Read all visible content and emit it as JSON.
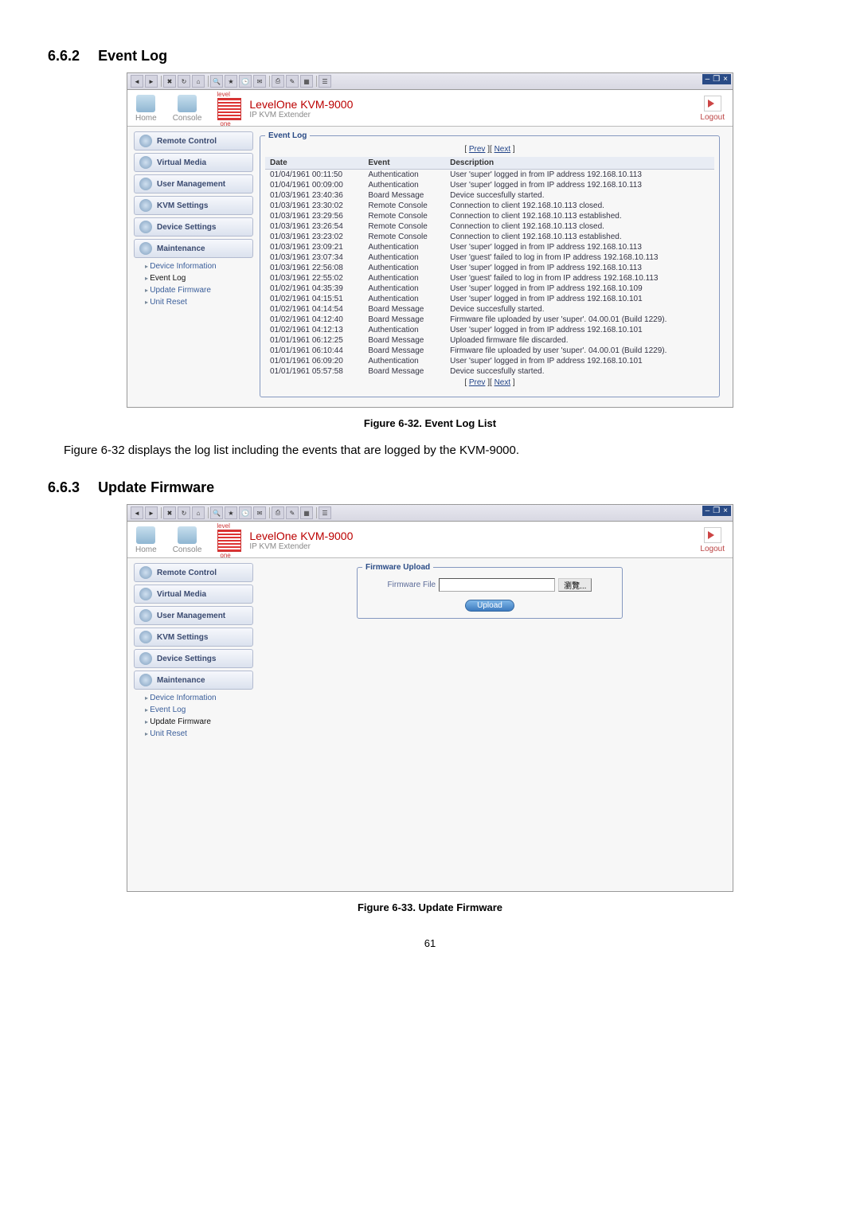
{
  "page_number": "61",
  "sections": {
    "s662": {
      "num": "6.6.2",
      "title": "Event Log"
    },
    "s663": {
      "num": "6.6.3",
      "title": "Update Firmware"
    }
  },
  "fig32": {
    "caption": "Figure 6-32. Event Log List"
  },
  "fig33": {
    "caption": "Figure 6-33. Update Firmware"
  },
  "body_line": "Figure 6-32 displays the log list including the events that are logged by the KVM-9000.",
  "brand": {
    "home": "Home",
    "console": "Console",
    "title": "LevelOne KVM-9000",
    "subtitle": "IP KVM Extender",
    "logout": "Logout"
  },
  "nav": {
    "remote_control": "Remote Control",
    "virtual_media": "Virtual Media",
    "user_management": "User Management",
    "kvm_settings": "KVM Settings",
    "device_settings": "Device Settings",
    "maintenance": "Maintenance",
    "device_information": "Device Information",
    "event_log": "Event Log",
    "update_firmware": "Update Firmware",
    "unit_reset": "Unit Reset"
  },
  "eventlog": {
    "legend": "Event Log",
    "prev": "Prev",
    "next": "Next",
    "columns": {
      "date": "Date",
      "event": "Event",
      "description": "Description"
    },
    "rows": [
      {
        "date": "01/04/1961 00:11:50",
        "event": "Authentication",
        "desc": "User 'super' logged in from IP address 192.168.10.113"
      },
      {
        "date": "01/04/1961 00:09:00",
        "event": "Authentication",
        "desc": "User 'super' logged in from IP address 192.168.10.113"
      },
      {
        "date": "01/03/1961 23:40:36",
        "event": "Board Message",
        "desc": "Device succesfully started."
      },
      {
        "date": "01/03/1961 23:30:02",
        "event": "Remote Console",
        "desc": "Connection to client 192.168.10.113 closed."
      },
      {
        "date": "01/03/1961 23:29:56",
        "event": "Remote Console",
        "desc": "Connection to client 192.168.10.113 established."
      },
      {
        "date": "01/03/1961 23:26:54",
        "event": "Remote Console",
        "desc": "Connection to client 192.168.10.113 closed."
      },
      {
        "date": "01/03/1961 23:23:02",
        "event": "Remote Console",
        "desc": "Connection to client 192.168.10.113 established."
      },
      {
        "date": "01/03/1961 23:09:21",
        "event": "Authentication",
        "desc": "User 'super' logged in from IP address 192.168.10.113"
      },
      {
        "date": "01/03/1961 23:07:34",
        "event": "Authentication",
        "desc": "User 'guest' failed to log in from IP address 192.168.10.113"
      },
      {
        "date": "01/03/1961 22:56:08",
        "event": "Authentication",
        "desc": "User 'super' logged in from IP address 192.168.10.113"
      },
      {
        "date": "01/03/1961 22:55:02",
        "event": "Authentication",
        "desc": "User 'guest' failed to log in from IP address 192.168.10.113"
      },
      {
        "date": "01/02/1961 04:35:39",
        "event": "Authentication",
        "desc": "User 'super' logged in from IP address 192.168.10.109"
      },
      {
        "date": "01/02/1961 04:15:51",
        "event": "Authentication",
        "desc": "User 'super' logged in from IP address 192.168.10.101"
      },
      {
        "date": "01/02/1961 04:14:54",
        "event": "Board Message",
        "desc": "Device succesfully started."
      },
      {
        "date": "01/02/1961 04:12:40",
        "event": "Board Message",
        "desc": "Firmware file uploaded by user 'super'. 04.00.01 (Build 1229)."
      },
      {
        "date": "01/02/1961 04:12:13",
        "event": "Authentication",
        "desc": "User 'super' logged in from IP address 192.168.10.101"
      },
      {
        "date": "01/01/1961 06:12:25",
        "event": "Board Message",
        "desc": "Uploaded firmware file discarded."
      },
      {
        "date": "01/01/1961 06:10:44",
        "event": "Board Message",
        "desc": "Firmware file uploaded by user 'super'. 04.00.01 (Build 1229)."
      },
      {
        "date": "01/01/1961 06:09:20",
        "event": "Authentication",
        "desc": "User 'super' logged in from IP address 192.168.10.101"
      },
      {
        "date": "01/01/1961 05:57:58",
        "event": "Board Message",
        "desc": "Device succesfully started."
      }
    ]
  },
  "firmware": {
    "legend": "Firmware Upload",
    "label": "Firmware File",
    "browse": "瀏覽...",
    "upload": "Upload",
    "value": ""
  },
  "window": {
    "min": "–",
    "restore": "❐",
    "close": "×"
  }
}
